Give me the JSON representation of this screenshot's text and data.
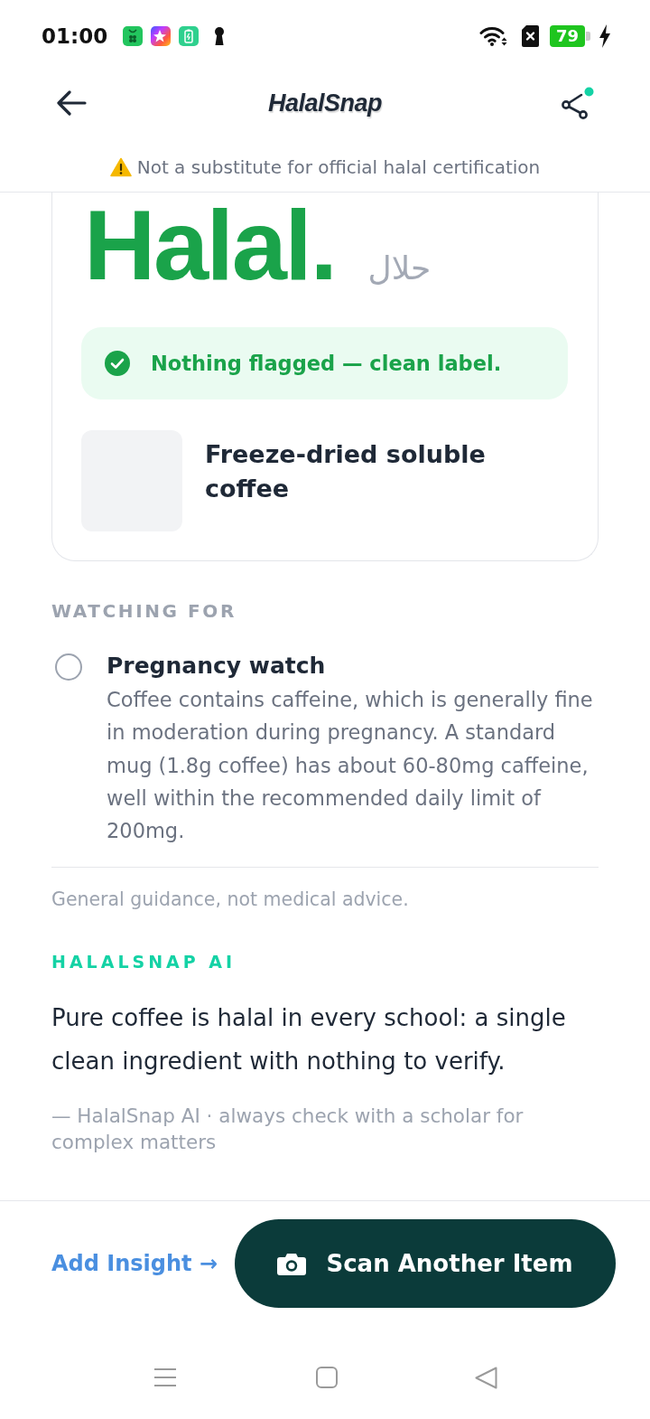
{
  "status_bar": {
    "time": "01:00",
    "battery": "79"
  },
  "header": {
    "title": "HalalSnap"
  },
  "disclaimer": {
    "text": "Not a substitute for official halal certification"
  },
  "verdict": {
    "kind": "halal",
    "label": "Halal.",
    "arabic": "حلال",
    "message": "Nothing flagged — clean label."
  },
  "product": {
    "name": "Freeze-dried soluble coffee"
  },
  "watching": {
    "heading": "WATCHING FOR",
    "items": [
      {
        "title": "Pregnancy watch",
        "checked": false,
        "description": "Coffee contains caffeine, which is generally fine in moderation during pregnancy. A standard mug (1.8g coffee) has about 60-80mg caffeine, well within the recommended daily limit of 200mg."
      }
    ],
    "note": "General guidance, not medical advice."
  },
  "ai": {
    "heading": "HALALSNAP AI",
    "quote": "Pure coffee is halal in every school: a single clean ingredient with nothing to verify.",
    "attribution": "— HalalSnap AI · always check with a scholar for complex matters"
  },
  "actions": {
    "link": "Add Insight →",
    "button": "Scan Another Item"
  }
}
